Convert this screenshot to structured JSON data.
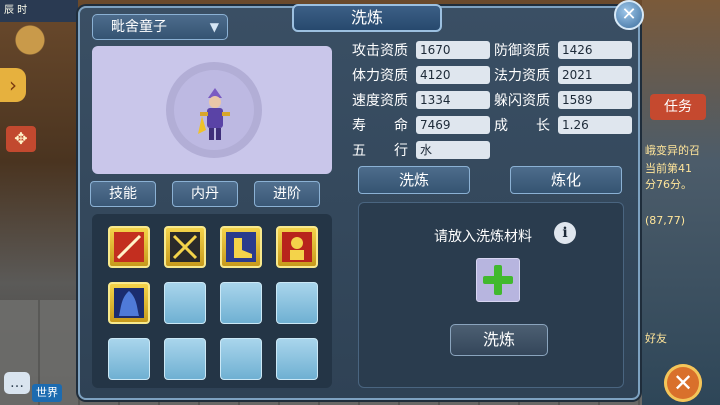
{
  "background": {
    "top_left_chip": "辰 时",
    "world_channel": "世界",
    "quest_button": "任务",
    "chat_lines": [
      "峨变异的召",
      "当前第41",
      "分76分。",
      "(87,77)",
      "好友"
    ]
  },
  "panel": {
    "title": "洗炼",
    "pet_name": "毗舍童子",
    "tabs": [
      "技能",
      "内丹",
      "进阶"
    ],
    "attributes": [
      {
        "label": "攻击资质",
        "value": "1670"
      },
      {
        "label": "防御资质",
        "value": "1426"
      },
      {
        "label": "体力资质",
        "value": "4120"
      },
      {
        "label": "法力资质",
        "value": "2021"
      },
      {
        "label": "速度资质",
        "value": "1334"
      },
      {
        "label": "躲闪资质",
        "value": "1589"
      },
      {
        "label": "寿　　命",
        "value": "7469"
      },
      {
        "label": "成　　长",
        "value": "1.26"
      },
      {
        "label": "五　　行",
        "value": "水"
      }
    ],
    "action_tabs": [
      "洗炼",
      "炼化"
    ],
    "hint": "请放入洗炼材料",
    "refine_button": "洗炼"
  },
  "colors": {
    "panel_bg": "#34495e",
    "accent_gold": "#f4d34a",
    "plus_green": "#41b92e"
  },
  "icons": {
    "close": "close-icon",
    "info": "info-icon",
    "add": "plus-icon",
    "dropdown": "chevron-down-icon"
  }
}
